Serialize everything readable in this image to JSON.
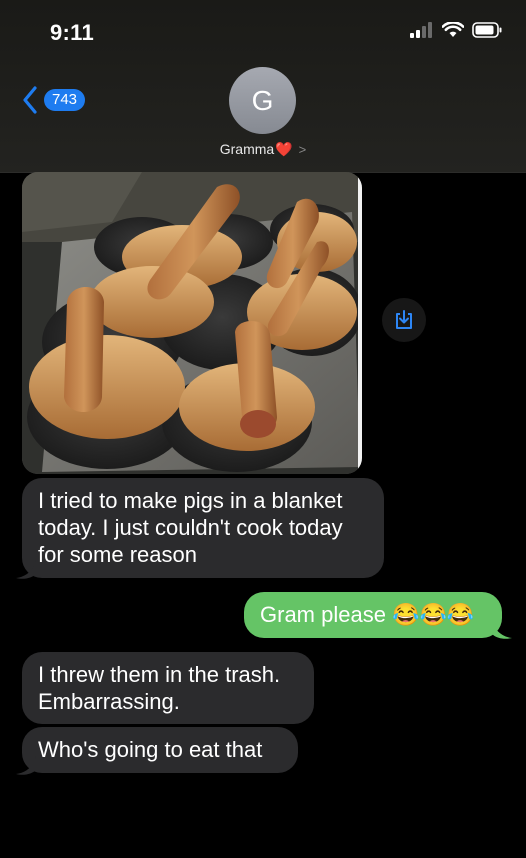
{
  "status_bar": {
    "time": "9:11"
  },
  "header": {
    "back_count": "743",
    "avatar_letter": "G",
    "contact_name": "Gramma",
    "contact_emoji": "❤️",
    "chevron": ">"
  },
  "messages": [
    {
      "from": "them",
      "type": "image",
      "icon": "pigs-in-blanket-photo"
    },
    {
      "from": "them",
      "text": "I tried to make pigs in a blanket today. I just couldn't cook today for some reason"
    },
    {
      "from": "me",
      "text": "Gram please 😂😂😂"
    },
    {
      "from": "them",
      "text": "I threw them in the trash. Embarrassing."
    },
    {
      "from": "them",
      "text": "Who's going to eat that"
    }
  ],
  "colors": {
    "incoming": "#2b2b2d",
    "outgoing": "#65c466",
    "accent": "#1e7cf0"
  }
}
